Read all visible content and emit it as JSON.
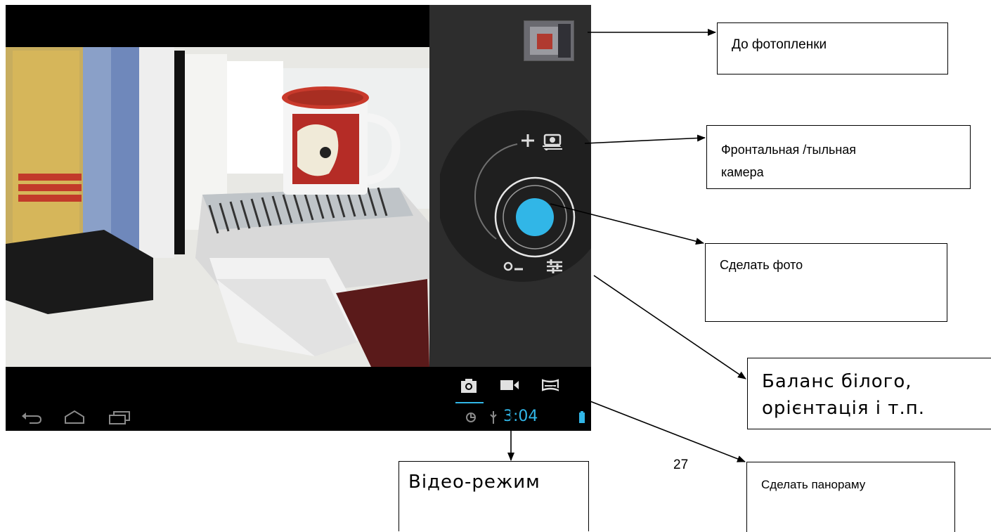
{
  "status_bar": {
    "time": "3:04"
  },
  "icons": {
    "back": "back-arrow-icon",
    "home": "home-icon",
    "recents": "recent-apps-icon",
    "gallery_thumbnail": "last-photo-thumbnail",
    "switch_camera": "switch-camera-icon",
    "shutter": "shutter-button",
    "settings": "settings-sliders-icon",
    "mode_photo": "camera-icon",
    "mode_video": "video-camera-icon",
    "mode_panorama": "panorama-icon"
  },
  "colors": {
    "accent": "#31b6e7",
    "panel": "#2d2d2d"
  },
  "zoom": {
    "plus_label": "+",
    "minus_label": "O–"
  },
  "annotations": {
    "film_roll": "До фотопленки",
    "front_rear_camera": "Фронтальная /тыльная\nкамера",
    "take_photo": "Сделать фото",
    "white_balance": "Баланс білого,\nорієнтація і т.п.",
    "video_mode": "Відео-режим",
    "panorama": "Сделать панораму"
  },
  "page_number": "27"
}
